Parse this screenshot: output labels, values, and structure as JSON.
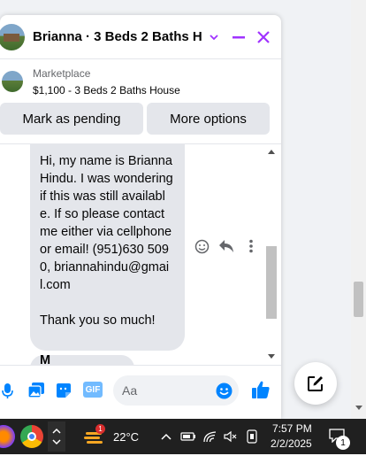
{
  "chat": {
    "title": "Brianna · 3 Beds 2 Baths H...",
    "marketplace_label": "Marketplace",
    "listing_title": "$1,100 - 3 Beds 2 Baths House",
    "mark_pending_label": "Mark as pending",
    "more_options_label": "More options"
  },
  "message": {
    "text": "Hi, my name is Brianna Hindu. I was wondering if this was still available. If so please contact me either via cellphone or email! (951)630 5090, briannahindu@gmail.com\n\nThank you so much!",
    "second_peek": "M"
  },
  "composer": {
    "placeholder": "Aa",
    "gif_label": "GIF"
  },
  "taskbar": {
    "temperature": "22°C",
    "weather_badge": "1",
    "time": "7:57 PM",
    "date": "2/2/2025",
    "notification_count": "1"
  },
  "colors": {
    "accent": "#a033ff",
    "messenger_blue": "#0084ff",
    "bubble_bg": "#e4e6eb",
    "taskbar_bg": "#202020"
  }
}
